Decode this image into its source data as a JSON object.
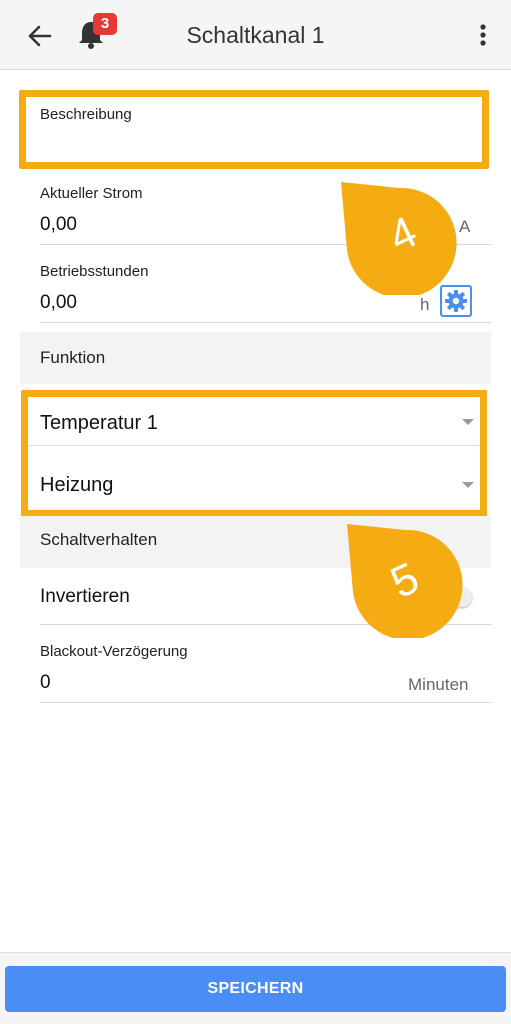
{
  "appbar": {
    "title": "Schaltkanal 1",
    "notification_count": "3",
    "back_icon": "arrow-left-icon",
    "bell_icon": "bell-icon",
    "menu_icon": "more-vert-icon"
  },
  "fields": {
    "beschreibung": {
      "label": "Beschreibung",
      "value": ""
    },
    "aktueller_strom": {
      "label": "Aktueller Strom",
      "value": "0,00",
      "unit": "A"
    },
    "betriebsstunden": {
      "label": "Betriebsstunden",
      "value": "0,00",
      "unit": "h"
    }
  },
  "funktion": {
    "title": "Funktion",
    "sensor": "Temperatur 1",
    "mode": "Heizung"
  },
  "schaltverhalten": {
    "title": "Schaltverhalten",
    "invertieren_label": "Invertieren",
    "invertieren_on": false
  },
  "blackout": {
    "label": "Blackout-Verzögerung",
    "value": "0",
    "unit": "Minuten"
  },
  "annotations": {
    "step_4": "4",
    "step_5": "5"
  },
  "footer": {
    "save_label": "SPEICHERN"
  },
  "colors": {
    "highlight": "#f5ab12",
    "accent": "#4a8ef5",
    "badge": "#e53935"
  }
}
